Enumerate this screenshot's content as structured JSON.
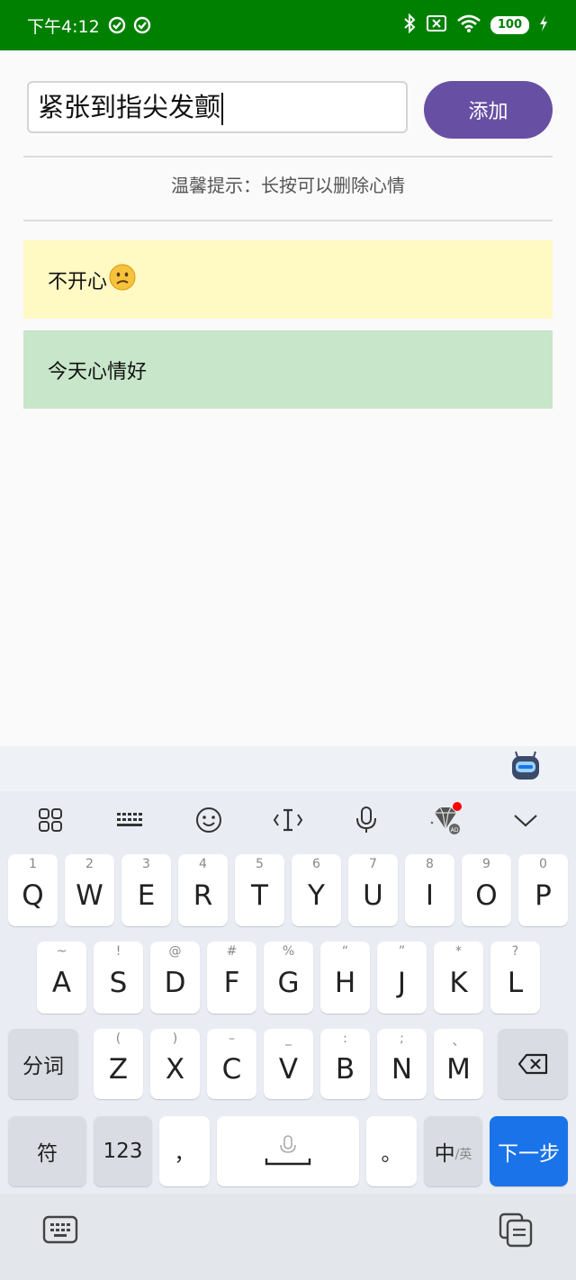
{
  "status_bar": {
    "time": "下午4:12",
    "battery": "100"
  },
  "input": {
    "value": "紧张到指尖发颤"
  },
  "add_button": {
    "label": "添加"
  },
  "hint": {
    "text": "温馨提示：长按可以删除心情"
  },
  "moods": [
    {
      "text": "不开心",
      "color": "#fff9c4",
      "emoji": "confused-face-icon"
    },
    {
      "text": "今天心情好",
      "color": "#c8e6c9"
    }
  ],
  "keyboard": {
    "row1": [
      {
        "hint": "1",
        "key": "Q"
      },
      {
        "hint": "2",
        "key": "W"
      },
      {
        "hint": "3",
        "key": "E"
      },
      {
        "hint": "4",
        "key": "R"
      },
      {
        "hint": "5",
        "key": "T"
      },
      {
        "hint": "6",
        "key": "Y"
      },
      {
        "hint": "7",
        "key": "U"
      },
      {
        "hint": "8",
        "key": "I"
      },
      {
        "hint": "9",
        "key": "O"
      },
      {
        "hint": "0",
        "key": "P"
      }
    ],
    "row2": [
      {
        "hint": "~",
        "key": "A"
      },
      {
        "hint": "!",
        "key": "S"
      },
      {
        "hint": "@",
        "key": "D"
      },
      {
        "hint": "#",
        "key": "F"
      },
      {
        "hint": "%",
        "key": "G"
      },
      {
        "hint": "“",
        "key": "H"
      },
      {
        "hint": "”",
        "key": "J"
      },
      {
        "hint": "*",
        "key": "K"
      },
      {
        "hint": "?",
        "key": "L"
      }
    ],
    "row3": [
      {
        "hint": "(",
        "key": "Z"
      },
      {
        "hint": ")",
        "key": "X"
      },
      {
        "hint": "–",
        "key": "C"
      },
      {
        "hint": "_",
        "key": "V"
      },
      {
        "hint": ":",
        "key": "B"
      },
      {
        "hint": ";",
        "key": "N"
      },
      {
        "hint": "、",
        "key": "M"
      }
    ],
    "fenci_label": "分词",
    "fu_label": "符",
    "num_label": "123",
    "comma_label": "，",
    "period_label": "。",
    "zh_label": "中",
    "en_label": "/英",
    "next_label": "下一步"
  }
}
